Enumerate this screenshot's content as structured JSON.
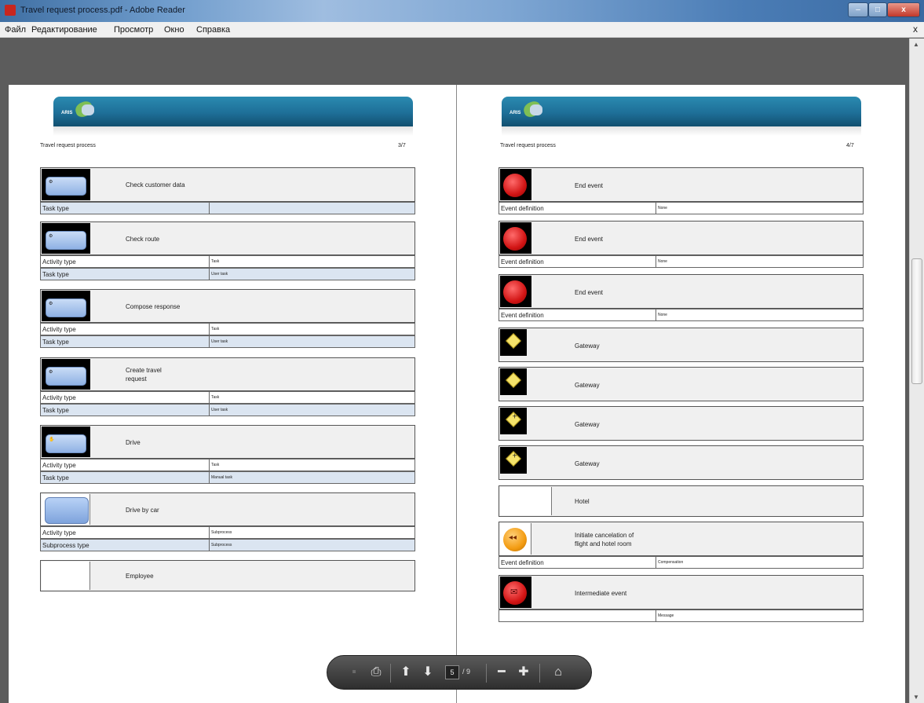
{
  "window": {
    "title": "Travel request process.pdf - Adobe Reader",
    "minimize": "–",
    "maximize": "□",
    "close": "x"
  },
  "menu": {
    "items": [
      "Файл",
      "Редактирование",
      "Просмотр",
      "Окно",
      "Справка"
    ],
    "doc_close": "x"
  },
  "pages": {
    "left": {
      "doc_title": "Travel request process",
      "page_number": "3/7",
      "logo_text": "ARIS",
      "objects": [
        {
          "name": "Check customer data",
          "attrs": [
            {
              "k": "Task type",
              "v": ""
            }
          ]
        },
        {
          "name": "Check route",
          "attrs": [
            {
              "k": "Activity type",
              "v": "Task"
            },
            {
              "k": "Task type",
              "v": "User task"
            }
          ]
        },
        {
          "name": "Compose response",
          "attrs": [
            {
              "k": "Activity type",
              "v": "Task"
            },
            {
              "k": "Task type",
              "v": "User task"
            }
          ]
        },
        {
          "name": "Create travel",
          "name2": "request",
          "attrs": [
            {
              "k": "Activity type",
              "v": "Task"
            },
            {
              "k": "Task type",
              "v": "User task"
            }
          ]
        },
        {
          "name": "Drive",
          "attrs": [
            {
              "k": "Activity type",
              "v": "Task"
            },
            {
              "k": "Task type",
              "v": "Manual task"
            }
          ]
        },
        {
          "name": "Drive by car",
          "attrs": [
            {
              "k": "Activity type",
              "v": "Subprocess"
            },
            {
              "k": "Subprocess type",
              "v": "Subprocess"
            }
          ]
        },
        {
          "name": "Employee",
          "attrs": []
        }
      ]
    },
    "right": {
      "doc_title": "Travel request process",
      "page_number": "4/7",
      "logo_text": "ARIS",
      "objects": [
        {
          "name": "End event",
          "attrs": [
            {
              "k": "Event definition",
              "v": "None"
            }
          ]
        },
        {
          "name": "End event",
          "attrs": [
            {
              "k": "Event definition",
              "v": "None"
            }
          ]
        },
        {
          "name": "End event",
          "attrs": [
            {
              "k": "Event definition",
              "v": "None"
            }
          ]
        },
        {
          "name": "Gateway",
          "attrs": []
        },
        {
          "name": "Gateway",
          "attrs": []
        },
        {
          "name": "Gateway",
          "attrs": []
        },
        {
          "name": "Gateway",
          "attrs": []
        },
        {
          "name": "Hotel",
          "attrs": []
        },
        {
          "name": "Initiate cancelation of",
          "name2": "flight and hotel room",
          "attrs": [
            {
              "k": "Event definition",
              "v": "Compensation"
            }
          ]
        },
        {
          "name": "Intermediate event",
          "attrs": [
            {
              "k": "",
              "v": "Message"
            }
          ]
        }
      ]
    }
  },
  "toolbar": {
    "current_page": "5",
    "total_pages": "/ 9"
  },
  "colors": {
    "banner": "#1e6f98",
    "alt_row": "#dbe5f1",
    "end_event": "#d21515",
    "gateway": "#f5e36b",
    "compensation": "#f39c12"
  }
}
